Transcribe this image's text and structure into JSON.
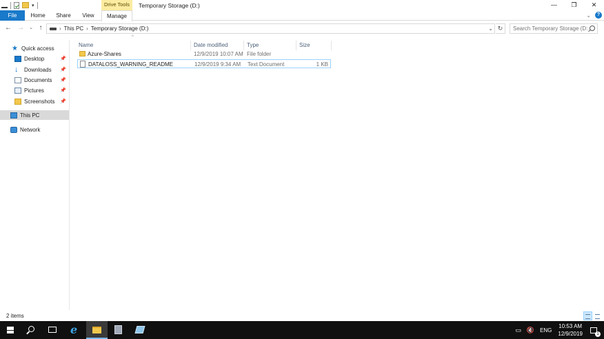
{
  "window": {
    "title": "Temporary Storage (D:)",
    "context_tab_group": "Drive Tools",
    "controls": {
      "minimize": "—",
      "restore": "❐",
      "close": "✕"
    }
  },
  "ribbon": {
    "tabs": [
      "File",
      "Home",
      "Share",
      "View",
      "Manage"
    ],
    "active_tab": "Manage",
    "accent_color": "#1979ca"
  },
  "address": {
    "breadcrumb": [
      "This PC",
      "Temporary Storage (D:)"
    ],
    "search_placeholder": "Search Temporary Storage (D:)"
  },
  "sidebar": {
    "quick_access": "Quick access",
    "items": [
      {
        "label": "Desktop",
        "icon": "desktop-icon",
        "pinned": true
      },
      {
        "label": "Downloads",
        "icon": "download-icon",
        "pinned": true
      },
      {
        "label": "Documents",
        "icon": "documents-icon",
        "pinned": true
      },
      {
        "label": "Pictures",
        "icon": "pictures-icon",
        "pinned": true
      },
      {
        "label": "Screenshots",
        "icon": "folder-icon",
        "pinned": true
      }
    ],
    "this_pc": "This PC",
    "network": "Network"
  },
  "files": {
    "columns": [
      "Name",
      "Date modified",
      "Type",
      "Size"
    ],
    "rows": [
      {
        "name": "Azure-Shares",
        "date": "12/9/2019 10:07 AM",
        "type": "File folder",
        "size": "",
        "icon": "folder-icon"
      },
      {
        "name": "DATALOSS_WARNING_README",
        "date": "12/9/2019 9:34 AM",
        "type": "Text Document",
        "size": "1 KB",
        "icon": "text-document-icon"
      }
    ]
  },
  "status": {
    "item_count": "2 items"
  },
  "taskbar": {
    "tray_language": "ENG",
    "clock_time": "10:53 AM",
    "clock_date": "12/9/2019",
    "notification_count": "1"
  }
}
